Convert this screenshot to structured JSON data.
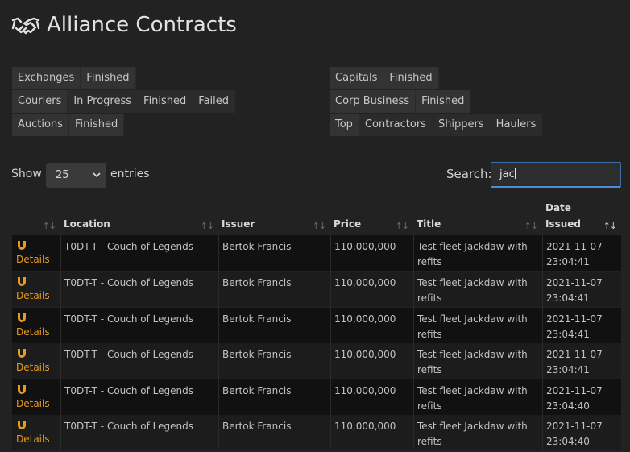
{
  "page": {
    "title": "Alliance Contracts"
  },
  "filters": {
    "exchanges": [
      "Exchanges",
      "Finished"
    ],
    "couriers": [
      "Couriers",
      "In Progress",
      "Finished",
      "Failed"
    ],
    "auctions": [
      "Auctions",
      "Finished"
    ],
    "capitals": [
      "Capitals",
      "Finished"
    ],
    "corp_business": [
      "Corp Business",
      "Finished"
    ],
    "top": [
      "Top",
      "Contractors",
      "Shippers",
      "Haulers"
    ]
  },
  "table_controls": {
    "show_label": "Show",
    "entries_value": "25",
    "entries_label": "entries",
    "search_label": "Search:",
    "search_value": "jac"
  },
  "columns": [
    "",
    "Location",
    "Issuer",
    "Price",
    "Title",
    "Date Issued"
  ],
  "column_title_lines": {
    "date_line1": "Date",
    "date_line2": "Issued"
  },
  "rows": [
    {
      "details": "Details",
      "location": "T0DT-T - Couch of Legends",
      "issuer": "Bertok Francis",
      "price": "110,000,000",
      "title_line1": "Test fleet Jackdaw with",
      "title_line2": "refits",
      "date": "2021-11-07",
      "time": "23:04:41"
    },
    {
      "details": "Details",
      "location": "T0DT-T - Couch of Legends",
      "issuer": "Bertok Francis",
      "price": "110,000,000",
      "title_line1": "Test fleet Jackdaw with",
      "title_line2": "refits",
      "date": "2021-11-07",
      "time": "23:04:41"
    },
    {
      "details": "Details",
      "location": "T0DT-T - Couch of Legends",
      "issuer": "Bertok Francis",
      "price": "110,000,000",
      "title_line1": "Test fleet Jackdaw with",
      "title_line2": "refits",
      "date": "2021-11-07",
      "time": "23:04:41"
    },
    {
      "details": "Details",
      "location": "T0DT-T - Couch of Legends",
      "issuer": "Bertok Francis",
      "price": "110,000,000",
      "title_line1": "Test fleet Jackdaw with",
      "title_line2": "refits",
      "date": "2021-11-07",
      "time": "23:04:41"
    },
    {
      "details": "Details",
      "location": "T0DT-T - Couch of Legends",
      "issuer": "Bertok Francis",
      "price": "110,000,000",
      "title_line1": "Test fleet Jackdaw with",
      "title_line2": "refits",
      "date": "2021-11-07",
      "time": "23:04:40"
    },
    {
      "details": "Details",
      "location": "T0DT-T - Couch of Legends",
      "issuer": "Bertok Francis",
      "price": "110,000,000",
      "title_line1": "Test fleet Jackdaw with",
      "title_line2": "refits",
      "date": "2021-11-07",
      "time": "23:04:40"
    }
  ],
  "icons": {
    "title": "handshake-icon",
    "row": "magnet-icon",
    "sort": "sort-arrows-icon"
  },
  "colors": {
    "accent": "#e89a1a",
    "focus": "#4b8bd8",
    "background": "#222222"
  }
}
